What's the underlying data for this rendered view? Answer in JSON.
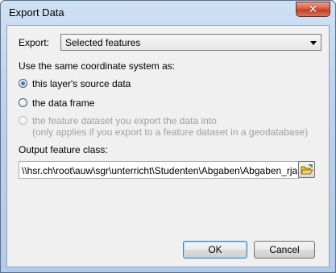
{
  "window": {
    "title": "Export Data",
    "close_glyph": "✕"
  },
  "export": {
    "label": "Export:",
    "selected": "Selected features"
  },
  "coord": {
    "heading": "Use the same coordinate system as:",
    "options": [
      {
        "label": "this layer's source data",
        "checked": true,
        "enabled": true
      },
      {
        "label": "the data frame",
        "checked": false,
        "enabled": true
      },
      {
        "label": "the feature dataset you export the data into",
        "sublabel": "(only applies if you export to a feature dataset in a geodatabase)",
        "checked": false,
        "enabled": false
      }
    ]
  },
  "output": {
    "label": "Output feature class:",
    "value": "\\\\hsr.ch\\root\\auw\\sgr\\unterricht\\Studenten\\Abgaben\\Abgaben_rjahn",
    "browse_icon": "folder-open-icon"
  },
  "buttons": {
    "ok": "OK",
    "cancel": "Cancel"
  },
  "colors": {
    "title_bg": "#bcd2ec",
    "client_bg": "#f0f0f0",
    "close_red": "#c3401f",
    "radio_fill": "#1a4aa0",
    "folder_yellow": "#e8c04a"
  }
}
